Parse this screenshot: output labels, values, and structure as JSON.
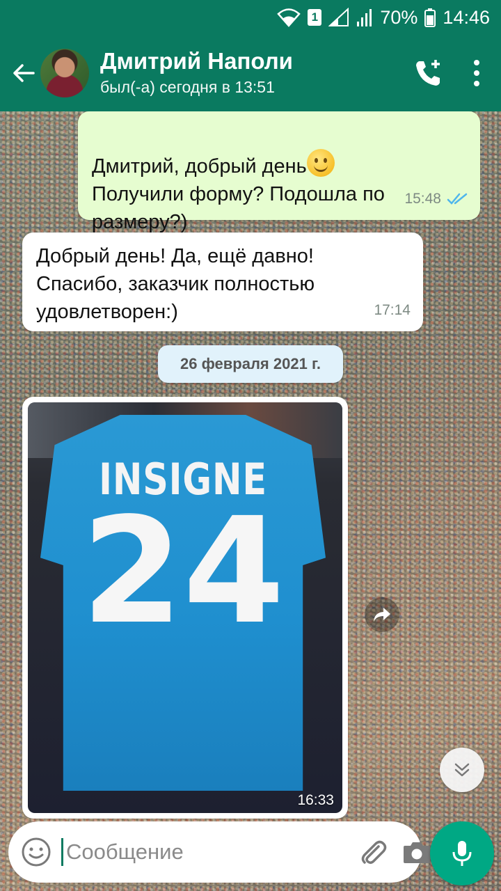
{
  "status_bar": {
    "battery": "70%",
    "time": "14:46",
    "sim": "1",
    "icons": [
      "wifi-icon",
      "sim-1-icon",
      "signal-icon",
      "signal-icon",
      "battery-icon"
    ]
  },
  "header": {
    "contact_name": "Дмитрий Наполи",
    "last_seen": "был(-а) сегодня в 13:51",
    "icons": [
      "back-arrow-icon",
      "avatar",
      "add-call-icon",
      "more-vert-icon"
    ]
  },
  "messages": [
    {
      "direction": "out",
      "text_before": "Дмитрий, добрый день",
      "text_after": "Получили форму? Подошла по\nразмеру?)",
      "time": "15:48",
      "status": "read"
    },
    {
      "direction": "in",
      "text": "Добрый день! Да, ещё давно!\nСпасибо, заказчик полностью\nудовлетворен:)",
      "time": "17:14"
    }
  ],
  "date_divider": "26 февраля 2021 г.",
  "image_message": {
    "direction": "in",
    "shirt_name": "INSIGNE",
    "shirt_number": "24",
    "time": "16:33"
  },
  "composer": {
    "placeholder": "Сообщение",
    "value": "",
    "icons": [
      "emoji-icon",
      "attach-icon",
      "camera-icon",
      "mic-icon"
    ]
  },
  "colors": {
    "header": "#0a7a60",
    "outgoing_bubble": "#e6fdd0",
    "incoming_bubble": "#ffffff",
    "read_ticks": "#4fb6ec",
    "mic_button": "#00a884"
  }
}
